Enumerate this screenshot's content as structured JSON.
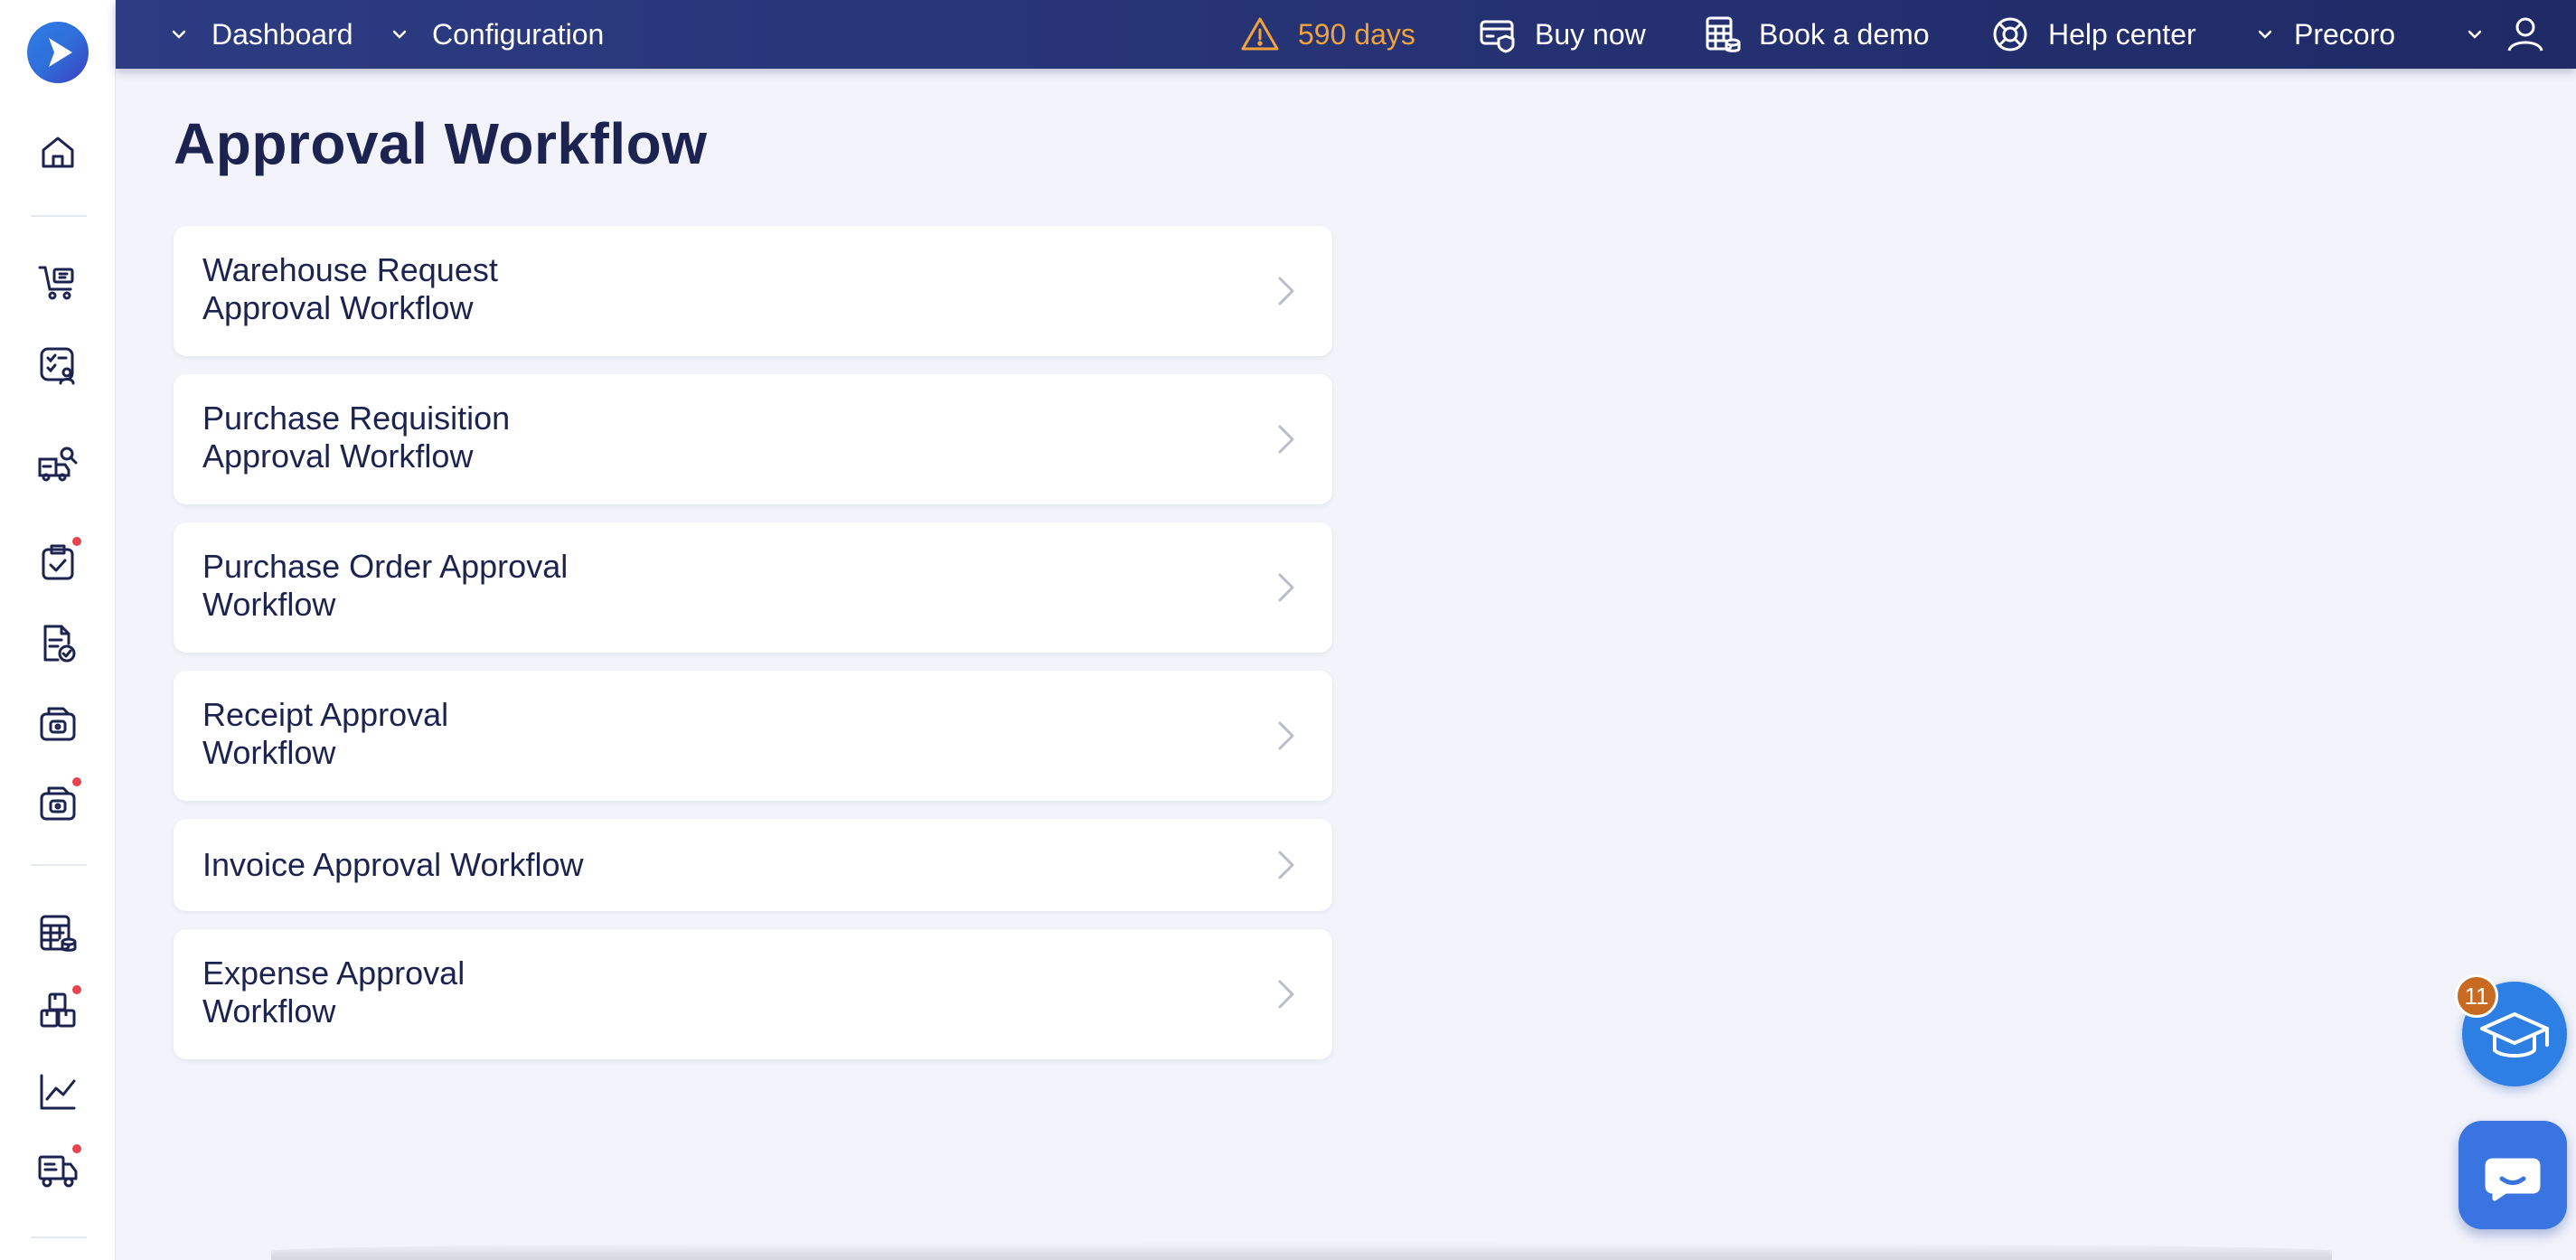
{
  "topbar": {
    "nav": [
      {
        "label": "Dashboard"
      },
      {
        "label": "Configuration"
      }
    ],
    "trial": {
      "label": "590 days"
    },
    "buy_label": "Buy now",
    "demo_label": "Book a demo",
    "help_label": "Help center",
    "company_label": "Precoro"
  },
  "page": {
    "title": "Approval Workflow"
  },
  "workflows": [
    {
      "label": "Warehouse Request\nApproval Workflow"
    },
    {
      "label": "Purchase Requisition\nApproval Workflow"
    },
    {
      "label": "Purchase Order Approval\nWorkflow"
    },
    {
      "label": "Receipt Approval\nWorkflow"
    },
    {
      "label": "Invoice Approval Workflow"
    },
    {
      "label": "Expense Approval\nWorkflow"
    }
  ],
  "academy": {
    "badge_count": "11"
  },
  "colors": {
    "topbar": "#2d3b82",
    "warning": "#f0a33c",
    "accent": "#2e7fe3",
    "badge": "#e8434e",
    "academy_badge": "#c96a22"
  },
  "sidebar_icons": [
    "home-icon",
    "shopping-cart-icon",
    "checklist-user-icon",
    "truck-search-icon",
    "clipboard-check-icon",
    "document-check-icon",
    "receipt-box-icon",
    "invoice-box-icon",
    "calculator-table-icon",
    "boxes-icon",
    "chart-icon",
    "truck-icon"
  ]
}
